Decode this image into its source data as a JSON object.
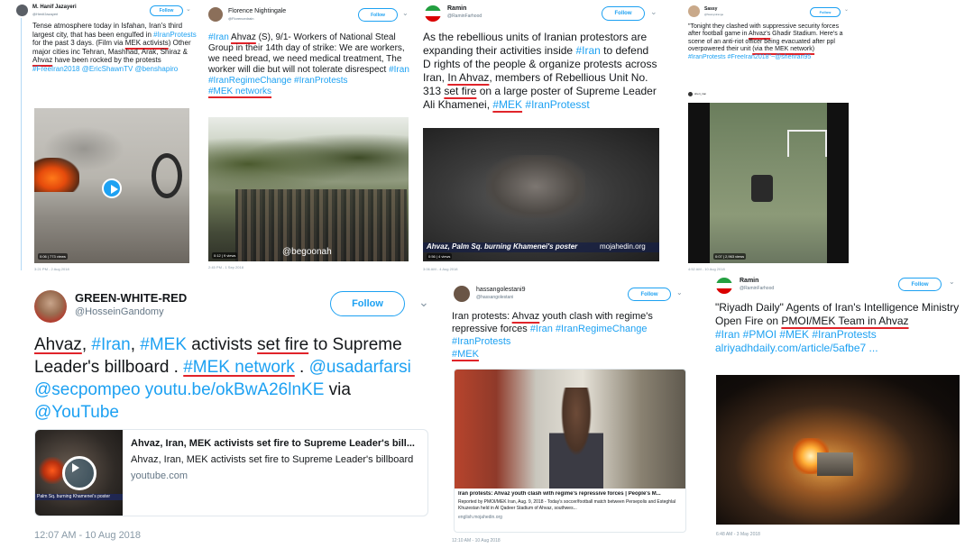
{
  "colors": {
    "link": "#1da1f2",
    "underline": "#e0242a",
    "text": "#14171a",
    "muted": "#657786"
  },
  "t1": {
    "name": "M. Hanif Jazayeri",
    "handle": "@HenifJazayeri",
    "follow": "Follow",
    "p1": "Tense atmosphere today in Isfahan, Iran's third largest city, that has been engulfed in ",
    "p2": "#IranProtests",
    "p3": " for the past 3 days. (Film via ",
    "p4": "MEK activists",
    "p5": ") Other major cities inc Tehran, Mashhad, Arak, Shiraz & ",
    "p6": "Ahvaz",
    "p7": " have been rocked by the protests ",
    "p8": "#FreeIran2018 @EricShawnTV @benshapiro",
    "badge": "0:06 | 773 views",
    "time": "3:21 PM - 2 Aug 2018"
  },
  "t2": {
    "name": "Florence Nightingale",
    "handle": "@Florencedrain",
    "follow": "Follow",
    "p1": "#Iran",
    "p2": "Ahvaz",
    "p3": " (S), 9/1- Workers of National Steal Group in their 14th day of strike: We are workers, we need bread, we need medical treatment, The worker will die but will not tolerate disrespect ",
    "p4": "#Iran #IranRegimeChange #IranProtests",
    "p5": "#MEK networks",
    "watermark": "@begoonah",
    "badge": "0:12 | 9 views",
    "time": "2:45 PM - 1 Sep 2018"
  },
  "t3": {
    "name": "Ramin",
    "handle": "@RaminFarhood",
    "follow": "Follow",
    "p1": "As the rebellious units of Iranian protestors are expanding their activities inside ",
    "p2": "#Iran",
    "p3": " to defend D rights of the people & organize protests across Iran, ",
    "p4": "In Ahvaz",
    "p5": ", members of Rebellious Unit No. 313 ",
    "p6": "set fire",
    "p7": " on a large poster of Supreme Leader Ali Khamenei, ",
    "p8": "#MEK",
    "p9": " #IranProtesst",
    "caption": "Ahvaz, Palm Sq. burning Khamenei's poster",
    "site": "mojahedin.org",
    "badge": "0:56 | 4 views",
    "time": "3:06 AM - 4 Aug 2018"
  },
  "t4": {
    "name": "Sassy",
    "handle": "@Sassystrange",
    "follow": "Follow",
    "p1": "\"Tonight they clashed with suppressive security forces after football game in ",
    "p2": "Ahvaz's",
    "p3": " Ghadir Stadium. Here's a scene of an anti-riot officer being evacuated after ppl overpowered their unit ",
    "p4": "(via the MEK network)",
    "p5": " #IranProtests #FreeIran2018\"~@sheriran95",
    "quoted": "sheri_iran",
    "badge": "0:07 | 2,963 views",
    "time": "4:52 AM - 10 Aug 2018"
  },
  "t5": {
    "name": "GREEN-WHITE-RED",
    "handle": "@HosseinGandomy",
    "follow": "Follow",
    "p1": "Ahvaz",
    "p2": ", ",
    "p3": "#Iran",
    "p4": ", ",
    "p5": "#MEK",
    "p6": " activists ",
    "p7": "set fire",
    "p8": " to Supreme Leader's billboard . ",
    "p9": "#MEK network",
    "p10": " . ",
    "p11": "@usadarfarsi @secpompeo youtu.be/okBwA26lnKE",
    "p12": " via ",
    "p13": "@YouTube",
    "card_title": "Ahvaz, Iran, MEK activists set fire to Supreme Leader's bill...",
    "card_desc": "Ahvaz, Iran, MEK activists set fire to Supreme Leader's billboard",
    "card_site": "youtube.com",
    "thumb_caption": "Palm Sq. burning Khamenei's poster",
    "time": "12:07 AM - 10 Aug 2018"
  },
  "t6": {
    "name": "hassangolestani9",
    "handle": "@hassangolestani",
    "follow": "Follow",
    "p1": "Iran protests: ",
    "p2": "Ahvaz",
    "p3": " youth clash with regime's repressive forces ",
    "p4": "#Iran #IranRegimeChange #IranProtests",
    "p5": "#MEK",
    "card_title": "Iran protests: Ahvaz youth clash with regime's repressive forces | People's M...",
    "card_desc": "Reported by PMOI/MEK Iran, Aug. 9, 2018 - Today's soccer/football match between Persepolis and Esteghlal Khuzestan held in Al Qadeer Stadium of Ahvaz, southwes...",
    "card_site": "english.mojahedin.org",
    "time": "12:10 AM - 10 Aug 2018"
  },
  "t7": {
    "name": "Ramin",
    "handle": "@RaminFarhood",
    "follow": "Follow",
    "p1": "\"Riyadh Daily\"\nAgents of Iran's Intelligence Ministry Open Fire on ",
    "p2": "PMOI/MEK Team in Ahvaz",
    "p3": "#Iran #PMOI #MEK #IranProtests alriyadhdaily.com/article/5afbe7 ...",
    "time": "6:48 AM - 3 May 2018"
  }
}
